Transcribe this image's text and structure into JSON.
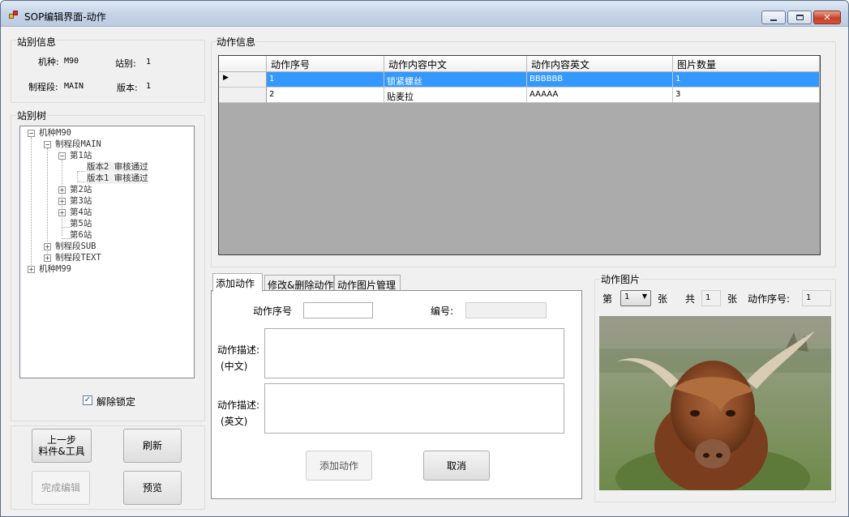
{
  "window": {
    "title": "SOP编辑界面-动作"
  },
  "station_info": {
    "group_label": "站别信息",
    "model_label": "机种:",
    "model_value": "M90",
    "station_label": "站别:",
    "station_value": "1",
    "process_label": "制程段:",
    "process_value": "MAIN",
    "version_label": "版本:",
    "version_value": "1"
  },
  "station_tree": {
    "group_label": "站别树",
    "nodes": [
      {
        "label": "机种M90",
        "toggle": "−"
      },
      {
        "label": "制程段MAIN",
        "toggle": "−"
      },
      {
        "label": "第1站",
        "toggle": "−"
      },
      {
        "label": "版本2 审核通过"
      },
      {
        "label": "版本1 审核通过"
      },
      {
        "label": "第2站",
        "toggle": "+"
      },
      {
        "label": "第3站",
        "toggle": "+"
      },
      {
        "label": "第4站",
        "toggle": "+"
      },
      {
        "label": "第5站"
      },
      {
        "label": "第6站"
      },
      {
        "label": "制程段SUB",
        "toggle": "+"
      },
      {
        "label": "制程段TEXT",
        "toggle": "+"
      },
      {
        "label": "机种M99",
        "toggle": "+"
      }
    ],
    "unlock_label": "解除锁定",
    "unlock_checked": true
  },
  "buttons": {
    "prev_step_line1": "上一步",
    "prev_step_line2": "料件&工具",
    "refresh": "刷新",
    "finish_edit": "完成编辑",
    "preview": "预览"
  },
  "action_info": {
    "group_label": "动作信息",
    "columns": [
      "动作序号",
      "动作内容中文",
      "动作内容英文",
      "图片数量"
    ],
    "rows": [
      [
        "1",
        "锁紧螺丝",
        "BBBBBB",
        "1"
      ],
      [
        "2",
        "贴麦拉",
        "AAAAA",
        "3"
      ]
    ],
    "row_indicator": "▶"
  },
  "tabs": [
    "添加动作",
    "修改&删除动作",
    "动作图片管理"
  ],
  "add_action": {
    "seq_label": "动作序号",
    "seq_value": "",
    "code_label": "编号:",
    "code_value": "",
    "desc_cn_label_1": "动作描述:",
    "desc_cn_label_2": "(中文)",
    "desc_en_label_1": "动作描述:",
    "desc_en_label_2": "(英文)",
    "add_button": "添加动作",
    "cancel_button": "取消"
  },
  "action_image": {
    "group_label": "动作图片",
    "page_prefix": "第",
    "page_value": "1",
    "page_suffix": "张",
    "total_prefix": "共",
    "total_value": "1",
    "total_suffix": "张",
    "seq_label": "动作序号:",
    "seq_value": "1"
  },
  "colors": {
    "selection": "#3399ff",
    "grid_bg": "#ababab"
  },
  "icons": [
    "app-icon",
    "minimize-icon",
    "maximize-icon",
    "close-icon",
    "row-pointer-icon",
    "dropdown-arrow-icon",
    "checkbox-check-icon"
  ]
}
